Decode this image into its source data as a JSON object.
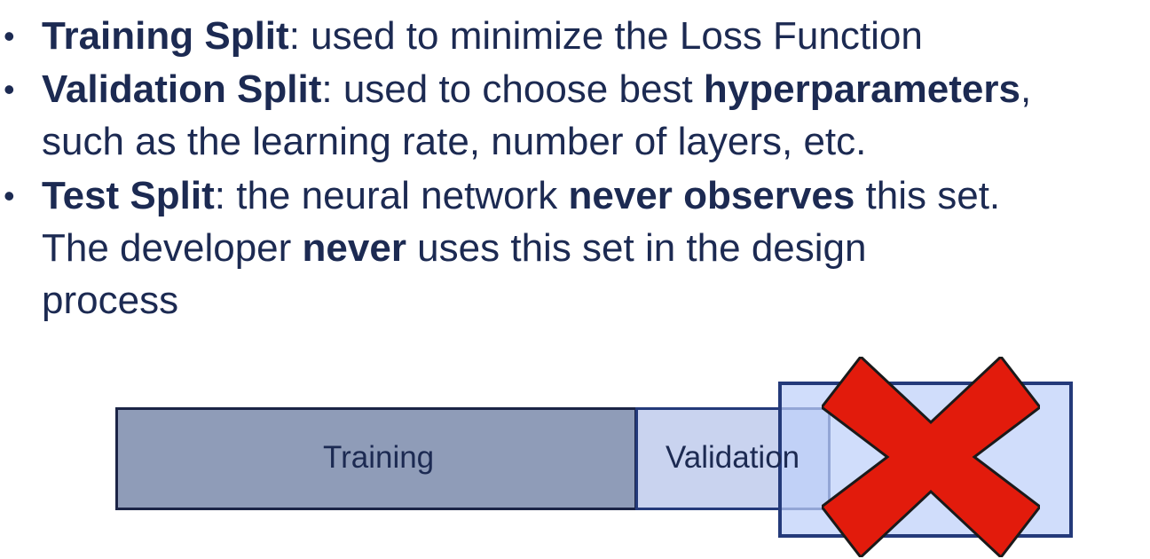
{
  "bullets": [
    {
      "bold": "Training Split",
      "text": ": used to minimize the Loss Function"
    },
    {
      "bold": "Validation Split",
      "text1": ": used to choose best ",
      "bold2": "hyperparameters",
      "text2": ",",
      "line2": "such as the learning rate, number of layers, etc."
    },
    {
      "bold": "Test Split",
      "text1": ": the neural network ",
      "bold2": "never observes",
      "text2": " this set.",
      "line2_a": "The developer ",
      "line2_bold": "never",
      "line2_b": " uses this set in the design",
      "line3": "process"
    }
  ],
  "bullet_symbol": "•",
  "diagram": {
    "training_label": "Training",
    "validation_label": "Validation",
    "cross_icon": "red-x-icon",
    "colors": {
      "training_fill": "#8f9cb8",
      "validation_fill": "#c9d3ef",
      "test_fill": "#bed0fa",
      "border": "#243a7a",
      "cross_fill": "#e21b0c"
    }
  }
}
